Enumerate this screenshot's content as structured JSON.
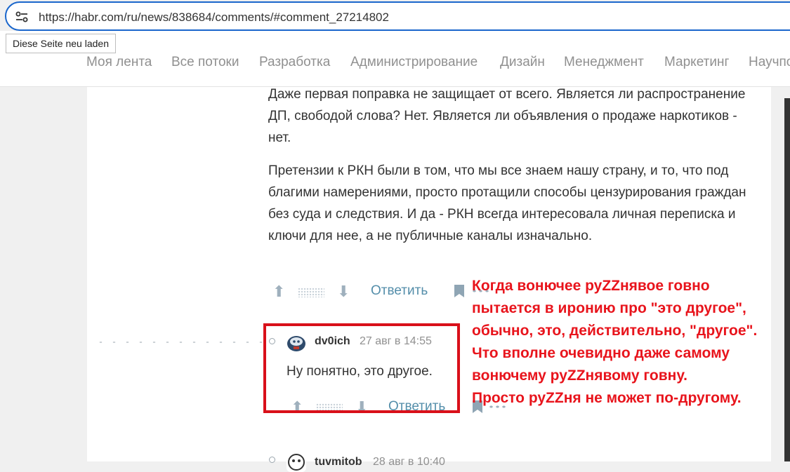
{
  "browser": {
    "url": "https://habr.com/ru/news/838684/comments/#comment_27214802",
    "reload_tooltip": "Diese Seite neu laden",
    "accent": "#1a66cc"
  },
  "nav": {
    "items": [
      "Моя лента",
      "Все потоки",
      "Разработка",
      "Администрирование",
      "Дизайн",
      "Менеджмент",
      "Маркетинг",
      "Научпо"
    ]
  },
  "comment_parent": {
    "paragraphs": [
      "Даже первая поправка не защищает от всего. Является ли распространение ДП, свободой слова? Нет. Является ли объявления о продаже наркотиков - нет.",
      "Претензии к РКН были в том, что мы все знаем нашу страну, и то, что под благими намерениями, просто протащили способы цензурирования граждан без суда и следствия. И да - РКН всегда интересовала личная переписка и ключи для нее, а не публичные каналы изначально."
    ],
    "reply_label": "Ответить"
  },
  "comment_reply": {
    "username": "dv0ich",
    "date": "27 авг в 14:55",
    "text": "Ну понятно, это другое.",
    "reply_label": "Ответить"
  },
  "comment_next": {
    "username": "tuvmitob",
    "date": "28 авг в 10:40"
  },
  "annotation": {
    "lines": [
      "Когда вонючее руZZнявое говно",
      "пытается в иронию про \"это другое\",",
      "обычно, это, действительно, \"другое\".",
      "Что вполне очевидно даже самому",
      "вонючему руZZнявому говну.",
      "Просто руZZня не может по-другому."
    ],
    "color": "#e8141c"
  },
  "highlight_color": "#d9101a"
}
